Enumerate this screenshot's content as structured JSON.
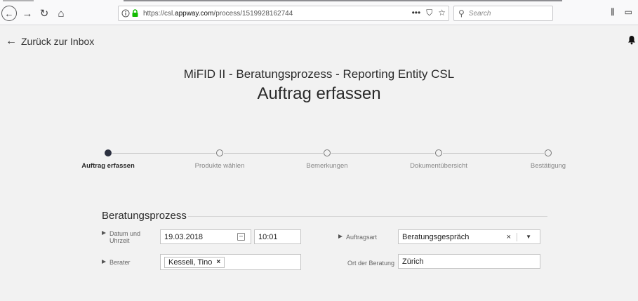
{
  "browser": {
    "url_prefix": "https://csl.",
    "url_domain": "appway.com",
    "url_path": "/process/1519928162744",
    "url_actions": {
      "more": "•••",
      "pocket": "⛉",
      "bookmark": "☆"
    },
    "search_placeholder": "Search",
    "icons": [
      "back-icon",
      "forward-icon",
      "reload-icon",
      "home-icon",
      "info-icon",
      "lock-icon",
      "library-icon",
      "sidebar-icon"
    ]
  },
  "header": {
    "back_label": "Zurück zur Inbox",
    "subtitle": "MiFID II - Beratungsprozess - Reporting Entity CSL",
    "title": "Auftrag erfassen"
  },
  "stepper": {
    "steps": [
      {
        "label": "Auftrag erfassen",
        "active": true
      },
      {
        "label": "Produkte wählen",
        "active": false
      },
      {
        "label": "Bemerkungen",
        "active": false
      },
      {
        "label": "Dokumentübersicht",
        "active": false
      },
      {
        "label": "Bestätigung",
        "active": false
      }
    ]
  },
  "form": {
    "section_title": "Beratungsprozess",
    "datum_label_1": "Datum und",
    "datum_label_2": "Uhrzeit",
    "datum_value": "19.03.2018",
    "zeit_value": "10:01",
    "auftragsart_label": "Auftragsart",
    "auftragsart_value": "Beratungsgespräch",
    "clear_symbol": "×",
    "berater_label": "Berater",
    "berater_chip": "Kesseli, Tino",
    "chip_remove": "×",
    "ort_label": "Ort der Beratung",
    "ort_value": "Zürich"
  },
  "colors": {
    "background": "#f2f2f2",
    "active_step": "#2c3140",
    "field_border": "#c4c4c4",
    "lock_green": "#12bc00"
  }
}
